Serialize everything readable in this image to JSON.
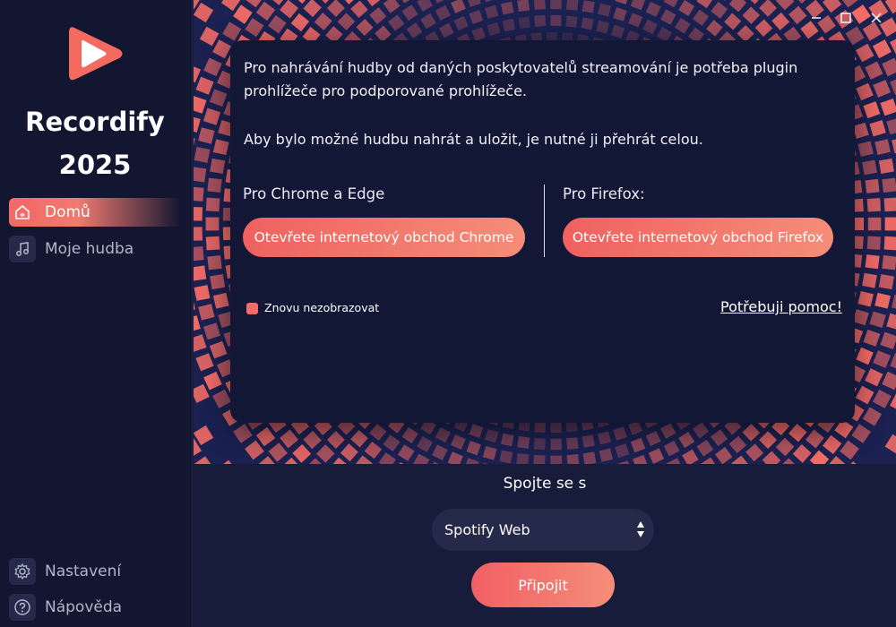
{
  "app": {
    "name_line1": "Recordify",
    "name_line2": "2025"
  },
  "sidebar": {
    "items": [
      {
        "label": "Domů",
        "icon": "home-icon",
        "active": true
      },
      {
        "label": "Moje hudba",
        "icon": "music-note-icon",
        "active": false
      }
    ],
    "bottom_items": [
      {
        "label": "Nastavení",
        "icon": "gear-icon"
      },
      {
        "label": "Nápověda",
        "icon": "help-circle-icon"
      }
    ]
  },
  "window_controls": [
    "minimize",
    "maximize",
    "close"
  ],
  "dialog": {
    "message_1": "Pro nahrávání hudby od daných poskytovatelů streamování je potřeba plugin prohlížeče pro podporované prohlížeče.",
    "message_2": "Aby bylo možné hudbu nahrát a uložit, je nutné ji přehrát celou.",
    "chrome_title": "Pro Chrome a Edge",
    "chrome_button": "Otevřete internetový obchod Chrome",
    "firefox_title": "Pro Firefox:",
    "firefox_button": "Otevřete internetový obchod Firefox",
    "dont_show_label": "Znovu nezobrazovat",
    "dont_show_checked": true,
    "help_link": "Potřebuji pomoc!"
  },
  "connect": {
    "label": "Spojte se s",
    "selected_service": "Spotify Web",
    "button": "Připojit"
  },
  "colors": {
    "accent": "#f36b66",
    "sidebar_bg": "#121631",
    "dialog_bg": "#131736",
    "page_bg": "#171c3b"
  }
}
